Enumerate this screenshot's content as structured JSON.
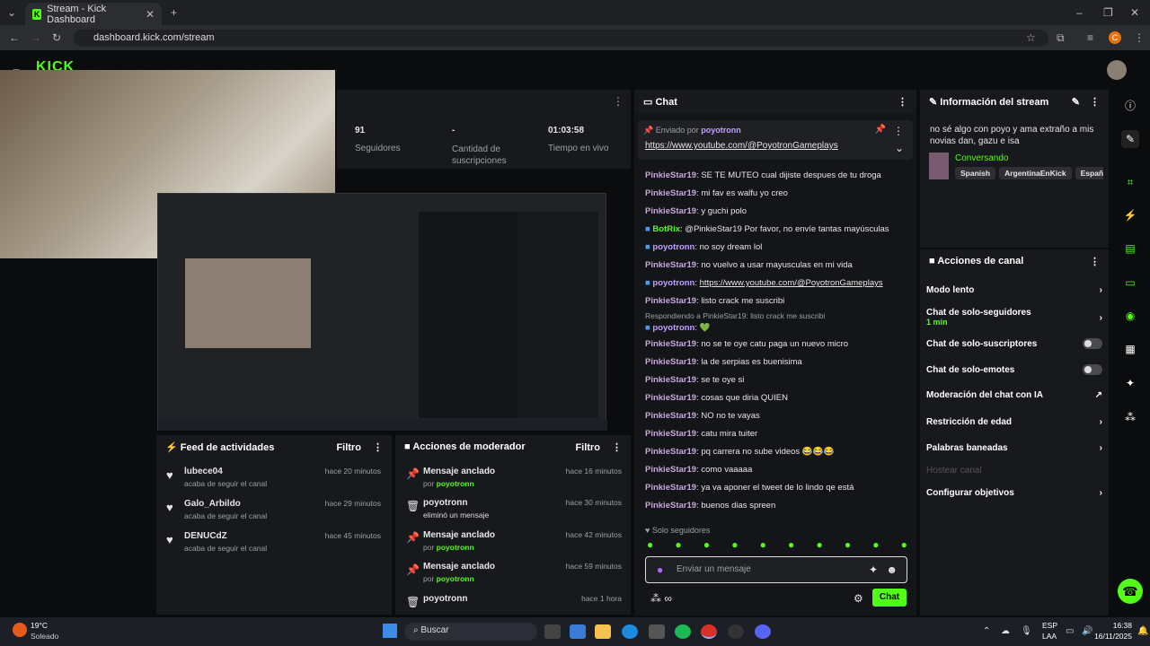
{
  "browser": {
    "tab_title": "Stream - Kick Dashboard",
    "url": "dashboard.kick.com/stream",
    "profile_initial": "C"
  },
  "stats": {
    "followers_value": "91",
    "followers_label": "Seguidores",
    "subs_value": "-",
    "subs_label": "Cantidad de suscripciones",
    "time_value": "01:03:58",
    "time_label": "Tiempo en vivo"
  },
  "chat": {
    "title": "Chat",
    "pinned_by_label": "Enviado por",
    "pinned_by_user": "poyotronn",
    "pinned_link": "https://www.youtube.com/@PoyotronGameplays",
    "messages": [
      {
        "user": "PinkieStar19",
        "text": "SE TE MUTEO cual dijiste despues de tu droga"
      },
      {
        "user": "PinkieStar19",
        "text": "mi fav es walfu yo creo"
      },
      {
        "user": "PinkieStar19",
        "text": "y guchi polo"
      },
      {
        "user": "BotRix",
        "text": "@PinkieStar19 Por favor, no envíe tantas mayúsculas"
      },
      {
        "user": "poyotronn",
        "text": "no soy dream lol"
      },
      {
        "user": "PinkieStar19",
        "text": "no vuelvo a usar mayusculas en mi vida"
      },
      {
        "user": "poyotronn",
        "text": "https://www.youtube.com/@PoyotronGameplays"
      },
      {
        "user": "PinkieStar19",
        "text": "listo crack me suscribi"
      },
      {
        "user": "poyotronn",
        "text": "💚",
        "reply": "Respondiendo a PinkieStar19: listo crack me suscribi"
      },
      {
        "user": "PinkieStar19",
        "text": "no se te oye catu paga un nuevo micro"
      },
      {
        "user": "PinkieStar19",
        "text": "la de serpias es buenisima"
      },
      {
        "user": "PinkieStar19",
        "text": "se te oye si"
      },
      {
        "user": "PinkieStar19",
        "text": "cosas que diria QUIEN"
      },
      {
        "user": "PinkieStar19",
        "text": "NO no te vayas"
      },
      {
        "user": "PinkieStar19",
        "text": "catu mira tuiter"
      },
      {
        "user": "PinkieStar19",
        "text": "pq carrera no sube videos 😂😂😂"
      },
      {
        "user": "PinkieStar19",
        "text": "como vaaaaa"
      },
      {
        "user": "PinkieStar19",
        "text": "ya va aponer el tweet de lo lindo qe está"
      },
      {
        "user": "PinkieStar19",
        "text": "buenos dias spreen"
      }
    ],
    "followers_only": "Solo seguidores",
    "input_placeholder": "Enviar un mensaje",
    "send_label": "Chat"
  },
  "stream_info": {
    "title": "Información del stream",
    "stream_title": "no sé  algo con poyo y ama  extraño a mis novias dan, gazu e isa",
    "category": "Conversando",
    "tags": [
      "Spanish",
      "ArgentinaEnKick",
      "Españo"
    ]
  },
  "channel_actions": {
    "title": "Acciones de canal",
    "items": [
      {
        "label": "Modo lento",
        "type": "arrow"
      },
      {
        "label": "Chat de solo-seguidores",
        "sub": "1 min",
        "type": "arrow"
      },
      {
        "label": "Chat de solo-suscriptores",
        "type": "toggle"
      },
      {
        "label": "Chat de solo-emotes",
        "type": "toggle"
      },
      {
        "label": "Moderación del chat con IA",
        "type": "ext"
      },
      {
        "label": "Restricción de edad",
        "type": "arrow"
      },
      {
        "label": "Palabras baneadas",
        "type": "arrow"
      },
      {
        "label": "Hostear canal",
        "type": "disabled"
      },
      {
        "label": "Configurar objetivos",
        "type": "arrow"
      }
    ]
  },
  "activity_feed": {
    "title": "Feed de actividades",
    "filter": "Filtro",
    "items": [
      {
        "user": "lubece04",
        "action": "acaba de seguir el canal",
        "time": "hace 20 minutos"
      },
      {
        "user": "Galo_Arbildo",
        "action": "acaba de seguir el canal",
        "time": "hace 29 minutos"
      },
      {
        "user": "DENUCdZ",
        "action": "acaba de seguir el canal",
        "time": "hace 45 minutos"
      }
    ]
  },
  "mod_actions": {
    "title": "Acciones de moderador",
    "filter": "Filtro",
    "items": [
      {
        "title": "Mensaje anclado",
        "by_label": "por",
        "by": "poyotronn",
        "time": "hace 16 minutos",
        "icon": "pin"
      },
      {
        "title": "poyotronn",
        "by_label": "",
        "by": "eliminó un mensaje",
        "time": "hace 30 minutos",
        "icon": "trash"
      },
      {
        "title": "Mensaje anclado",
        "by_label": "por",
        "by": "poyotronn",
        "time": "hace 42 minutos",
        "icon": "pin"
      },
      {
        "title": "Mensaje anclado",
        "by_label": "por",
        "by": "poyotronn",
        "time": "hace 59 minutos",
        "icon": "pin"
      },
      {
        "title": "poyotronn",
        "by_label": "",
        "by": "",
        "time": "hace 1 hora",
        "icon": "trash"
      }
    ]
  },
  "taskbar": {
    "weather_temp": "19°C",
    "weather_desc": "Soleado",
    "search": "Buscar",
    "lang1": "ESP",
    "lang2": "LAA",
    "time": "16:38",
    "date": "16/11/2025"
  },
  "colors": {
    "accent": "#53fc18",
    "panel": "#18191c",
    "bg": "#0b0c0e"
  }
}
